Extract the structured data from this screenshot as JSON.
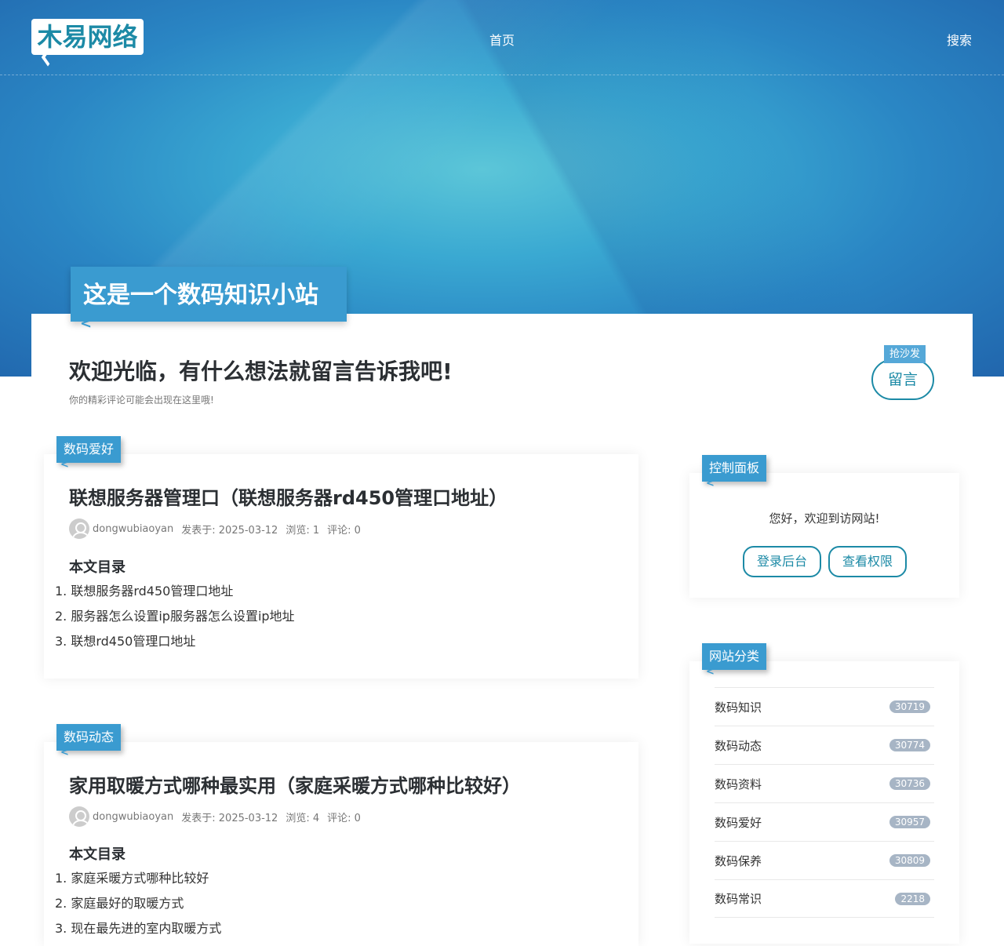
{
  "header": {
    "logo": "木易网络",
    "nav_home": "首页",
    "nav_search": "搜索"
  },
  "hero": {
    "tag": "这是一个数码知识小站"
  },
  "welcome": {
    "title": "欢迎光临，有什么想法就留言告诉我吧!",
    "subtitle": "你的精彩评论可能会出现在这里哦!",
    "sofa": "抢沙发",
    "message_button": "留言"
  },
  "posts": [
    {
      "category": "数码爱好",
      "title": "联想服务器管理口（联想服务器rd450管理口地址）",
      "author": "dongwubiaoyan",
      "date": "发表于: 2025-03-12",
      "views": "浏览: 1",
      "comments": "评论: 0",
      "toc_title": "本文目录",
      "toc": [
        "1. 联想服务器rd450管理口地址",
        "2. 服务器怎么设置ip服务器怎么设置ip地址",
        "3. 联想rd450管理口地址"
      ]
    },
    {
      "category": "数码动态",
      "title": "家用取暖方式哪种最实用（家庭采暖方式哪种比较好）",
      "author": "dongwubiaoyan",
      "date": "发表于: 2025-03-12",
      "views": "浏览: 4",
      "comments": "评论: 0",
      "toc_title": "本文目录",
      "toc": [
        "1. 家庭采暖方式哪种比较好",
        "2. 家庭最好的取暖方式",
        "3. 现在最先进的室内取暖方式"
      ]
    }
  ],
  "control_panel": {
    "tag": "控制面板",
    "greeting": "您好，欢迎到访网站!",
    "login": "登录后台",
    "permissions": "查看权限"
  },
  "categories": {
    "tag": "网站分类",
    "items": [
      {
        "name": "数码知识",
        "count": "30719"
      },
      {
        "name": "数码动态",
        "count": "30774"
      },
      {
        "name": "数码资料",
        "count": "30736"
      },
      {
        "name": "数码爱好",
        "count": "30957"
      },
      {
        "name": "数码保养",
        "count": "30809"
      },
      {
        "name": "数码常识",
        "count": "2218"
      }
    ]
  }
}
